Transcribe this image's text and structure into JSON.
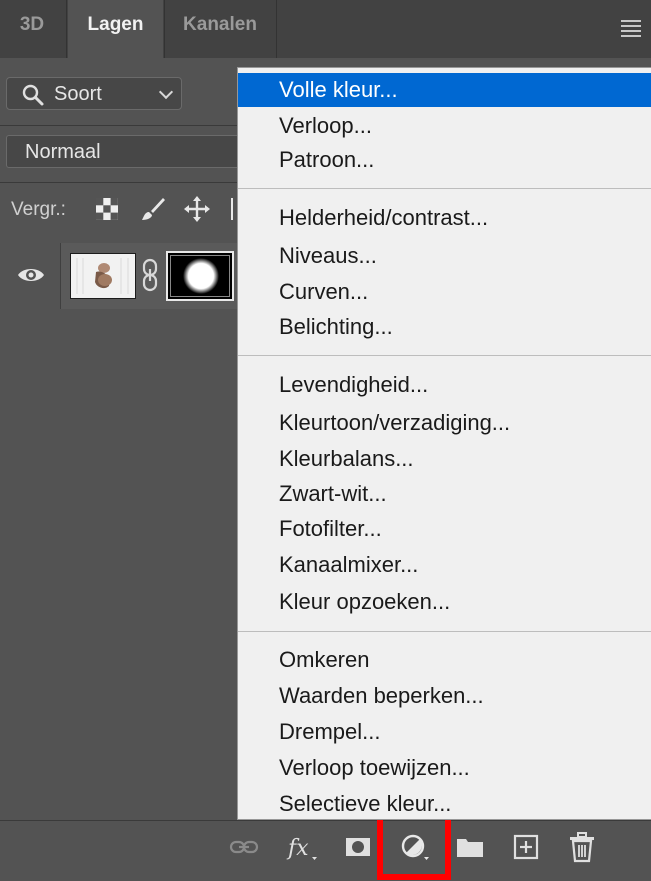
{
  "tabs": [
    {
      "label": "3D",
      "active": false
    },
    {
      "label": "Lagen",
      "active": true
    },
    {
      "label": "Kanalen",
      "active": false
    }
  ],
  "filter": {
    "label": "Soort"
  },
  "blend_mode": {
    "value": "Normaal"
  },
  "lock": {
    "label": "Vergr.:"
  },
  "menu": {
    "groups": [
      [
        "Volle kleur...",
        "Verloop...",
        "Patroon..."
      ],
      [
        "Helderheid/contrast...",
        "Niveaus...",
        "Curven...",
        "Belichting..."
      ],
      [
        "Levendigheid...",
        "Kleurtoon/verzadiging...",
        "Kleurbalans...",
        "Zwart-wit...",
        "Fotofilter...",
        "Kanaalmixer...",
        "Kleur opzoeken..."
      ],
      [
        "Omkeren",
        "Waarden beperken...",
        "Drempel...",
        "Verloop toewijzen...",
        "Selectieve kleur..."
      ]
    ],
    "selected": "Volle kleur..."
  },
  "bottom_bar": {
    "icons": [
      "link-layers-icon",
      "fx-icon",
      "add-mask-icon",
      "adjustment-layer-icon",
      "new-group-icon",
      "new-layer-icon",
      "delete-icon"
    ]
  },
  "colors": {
    "panel_bg": "#535353",
    "menu_bg": "#f0f0f0",
    "menu_selection": "#0068d2",
    "highlight_box": "#ff0000"
  }
}
